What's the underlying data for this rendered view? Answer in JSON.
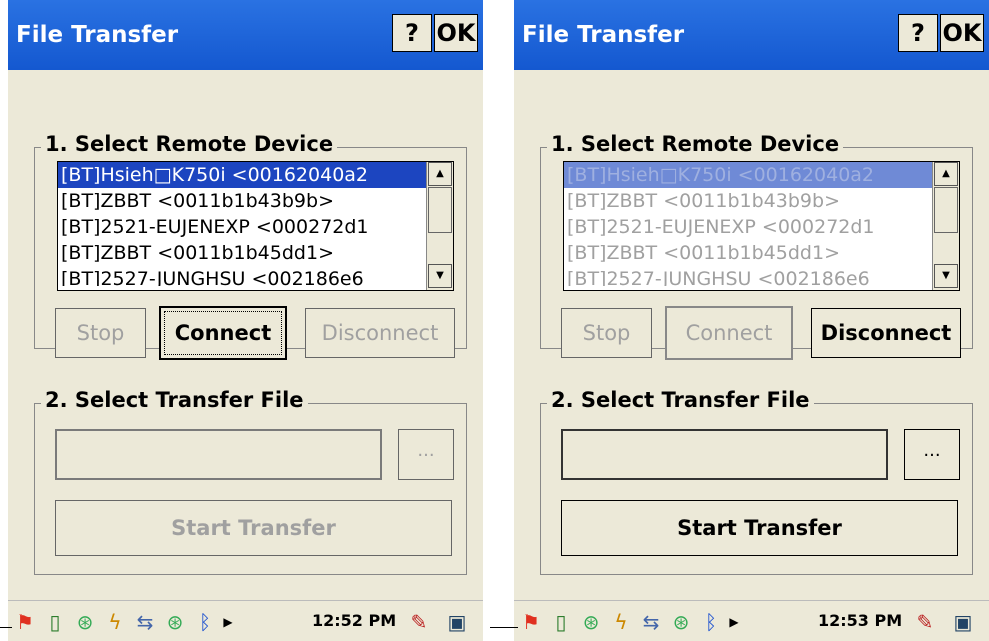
{
  "screens": [
    {
      "title": "File Transfer",
      "help_label": "?",
      "ok_label": "OK",
      "group1_label": "1. Select Remote Device",
      "devices": [
        "[BT]Hsieh□K750i <00162040a2",
        "[BT]ZBBT <0011b1b43b9b>",
        "[BT]2521-EUJENEXP <000272d1",
        "[BT]ZBBT <0011b1b45dd1>",
        "[BT]2527-JUNGHSU <002186e6"
      ],
      "stop_label": "Stop",
      "connect_label": "Connect",
      "disconnect_label": "Disconnect",
      "group2_label": "2. Select Transfer File",
      "file_path": "",
      "browse_label": "...",
      "start_label": "Start Transfer",
      "clock": "12:52 PM"
    },
    {
      "title": "File Transfer",
      "help_label": "?",
      "ok_label": "OK",
      "group1_label": "1. Select Remote Device",
      "devices": [
        "[BT]Hsieh□K750i <00162040a2",
        "[BT]ZBBT <0011b1b43b9b>",
        "[BT]2521-EUJENEXP <000272d1",
        "[BT]ZBBT <0011b1b45dd1>",
        "[BT]2527-JUNGHSU <002186e6"
      ],
      "stop_label": "Stop",
      "connect_label": "Connect",
      "disconnect_label": "Disconnect",
      "group2_label": "2. Select Transfer File",
      "file_path": "",
      "browse_label": "...",
      "start_label": "Start Transfer",
      "clock": "12:53 PM"
    }
  ],
  "icons": {
    "start": "windows-flag-icon",
    "tray": [
      "battery-icon",
      "network-icon",
      "power-icon",
      "sync-icon",
      "network-icon",
      "bluetooth-icon",
      "arrow-right-icon"
    ],
    "right": [
      "tools-icon",
      "desktop-switch-icon"
    ]
  }
}
